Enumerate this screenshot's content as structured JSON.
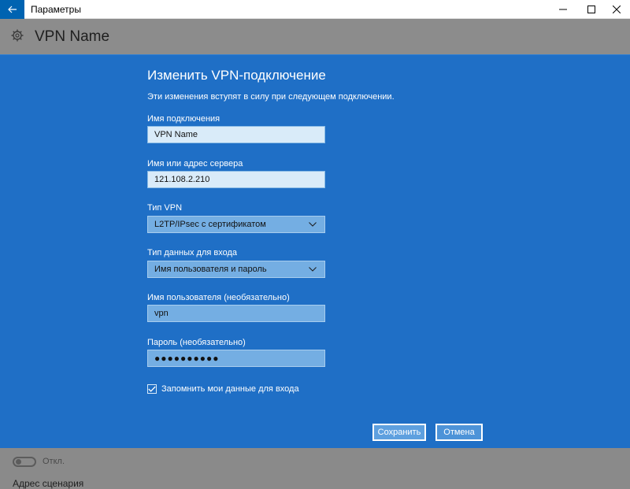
{
  "window": {
    "title": "Параметры"
  },
  "header": {
    "title": "VPN Name"
  },
  "dialog": {
    "title": "Изменить VPN-подключение",
    "note": "Эти изменения вступят в силу при следующем подключении.",
    "connection_name": {
      "label": "Имя подключения",
      "value": "VPN Name"
    },
    "server": {
      "label": "Имя или адрес сервера",
      "value": "121.108.2.210"
    },
    "vpn_type": {
      "label": "Тип VPN",
      "value": "L2TP/IPsec с сертификатом"
    },
    "signin_type": {
      "label": "Тип данных для входа",
      "value": "Имя пользователя и пароль"
    },
    "username": {
      "label": "Имя пользователя (необязательно)",
      "value": "vpn"
    },
    "password": {
      "label": "Пароль (необязательно)",
      "value": "●●●●●●●●●●"
    },
    "remember": {
      "label": "Запомнить мои данные для входа",
      "checked": true
    },
    "save_label": "Сохранить",
    "cancel_label": "Отмена"
  },
  "bottom": {
    "toggle_label": "Откл.",
    "script_label": "Адрес сценария"
  },
  "colors": {
    "accent": "#0063b1",
    "dialog_bg": "#1f6fc6"
  },
  "icons": {
    "back": "back-arrow-icon",
    "gear": "gear-icon",
    "minimize": "minimize-icon",
    "maximize": "maximize-icon",
    "close": "close-icon",
    "chevron": "chevron-down-icon",
    "check": "checkmark-icon"
  }
}
